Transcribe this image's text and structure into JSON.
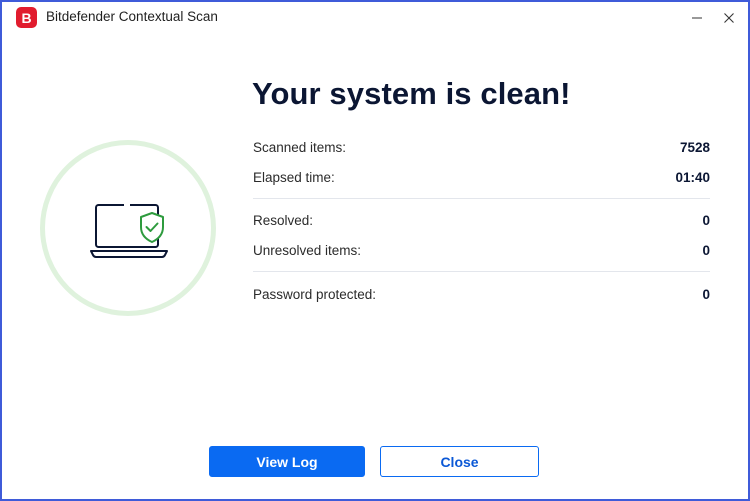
{
  "window": {
    "title": "Bitdefender Contextual Scan",
    "logo_letter": "B",
    "minimize_icon": "minimize-icon",
    "close_icon": "close-icon"
  },
  "colors": {
    "brand_red": "#e11c2e",
    "accent_blue": "#0a6af2",
    "success_green": "#2e9b3e",
    "ring_green": "#dff2dd",
    "heading": "#0b1633"
  },
  "status": {
    "headline": "Your system is clean!",
    "icon": "laptop-shield-check-icon"
  },
  "stats": [
    {
      "label": "Scanned items:",
      "value": "7528"
    },
    {
      "label": "Elapsed time:",
      "value": "01:40"
    },
    {
      "label": "Resolved:",
      "value": "0"
    },
    {
      "label": "Unresolved items:",
      "value": "0"
    },
    {
      "label": "Password protected:",
      "value": "0"
    }
  ],
  "actions": {
    "view_log": "View Log",
    "close": "Close"
  }
}
